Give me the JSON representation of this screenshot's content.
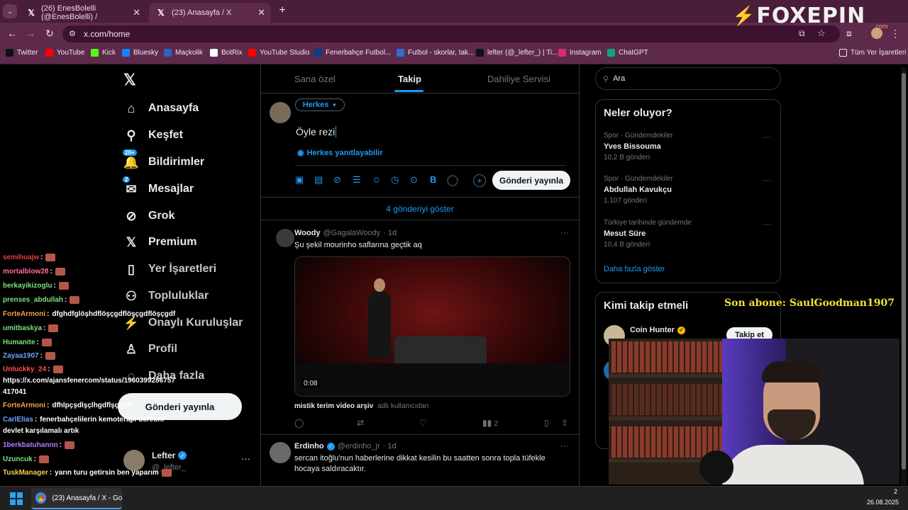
{
  "browser": {
    "tabs": [
      {
        "title": "(26) EnesBolelli (@EnesBolelli) /"
      },
      {
        "title": "(23) Anasayfa / X"
      }
    ],
    "url": "x.com/home",
    "bookmarks": [
      {
        "label": "Twitter"
      },
      {
        "label": "YouTube"
      },
      {
        "label": "Kick"
      },
      {
        "label": "Bluesky"
      },
      {
        "label": "Maçkolik"
      },
      {
        "label": "BotRix"
      },
      {
        "label": "YouTube Studio"
      },
      {
        "label": "Fenerbahçe Futbol..."
      },
      {
        "label": "Futbol - skorlar, tak..."
      },
      {
        "label": "lefter (@_lefter_) | Ti..."
      },
      {
        "label": "Instagram"
      },
      {
        "label": "ChatGPT"
      }
    ],
    "all_bookmarks": "Tüm Yer İşaretleri"
  },
  "overlay": {
    "logo_text": "FOXEPIN",
    "logo_sub": ".com",
    "son_abone": "Son abone: SaulGoodman1907"
  },
  "nav": {
    "items": [
      {
        "label": "Anasayfa"
      },
      {
        "label": "Keşfet"
      },
      {
        "label": "Bildirimler",
        "badge": "20+"
      },
      {
        "label": "Mesajlar",
        "badge": "2"
      },
      {
        "label": "Grok"
      },
      {
        "label": "Premium"
      },
      {
        "label": "Yer İşaretleri"
      },
      {
        "label": "Topluluklar"
      },
      {
        "label": "Onaylı Kuruluşlar"
      },
      {
        "label": "Profil"
      },
      {
        "label": "Daha fazla"
      }
    ],
    "post_button": "Gönderi yayınla",
    "account_name": "Lefter",
    "account_handle": "@_lefter_"
  },
  "timeline": {
    "tabs": [
      {
        "label": "Sana özel"
      },
      {
        "label": "Takip"
      },
      {
        "label": "Dahiliye Servisi"
      }
    ],
    "compose": {
      "audience": "Herkes",
      "text": "Öyle rezi",
      "reply_setting": "Herkes yanıtlayabilir",
      "post_button": "Gönderi yayınla"
    },
    "show_more": "4 gönderiyi göster",
    "posts": [
      {
        "name": "Woody",
        "handle": "@GagalaWoody",
        "time": "· 1d",
        "text": "Şu şekil mourinho saflarına geçtik aq",
        "video_time": "0:08",
        "caption_link": "mistik terim video arşiv",
        "caption_rest": "adlı kullanıcıdan",
        "views": "2"
      },
      {
        "name": "Erdinho",
        "handle": "@erdinho_jr",
        "time": "· 1d",
        "text": "sercan itoğlu'nun haberlerine dikkat kesilin bu saatten sonra topla tüfekle hocaya saldıracaktır."
      }
    ]
  },
  "sidebar": {
    "search_placeholder": "Ara",
    "trends_title": "Neler oluyor?",
    "trends": [
      {
        "meta": "Spor · Gündemdekiler",
        "title": "Yves Bissouma",
        "count": "10,2 B gönderi"
      },
      {
        "meta": "Spor · Gündemdekiler",
        "title": "Abdullah Kavukçu",
        "count": "1.107 gönderi"
      },
      {
        "meta": "Türkiye tarihinde gündemde",
        "title": "Mesut Süre",
        "count": "10,4 B gönderi"
      }
    ],
    "show_more": "Daha fazla göster",
    "who_to_follow": "Kimi takip etmeli",
    "suggestion_name": "Coin Hunter",
    "follow_button": "Takip et"
  },
  "chat": [
    {
      "user": "semihuajw",
      "msg": "",
      "color": "#e0403a"
    },
    {
      "user": "mortalblow28",
      "msg": "",
      "color": "#ff6fa0"
    },
    {
      "user": "berkayikizoglu",
      "msg": "",
      "color": "#7ee07e"
    },
    {
      "user": "prenses_abdullah",
      "msg": "",
      "color": "#7ee07e"
    },
    {
      "user": "ForteArmoni",
      "msg": "dfghdfglöşhdflöşçgdflöşçgdflöşçgdf",
      "color": "#f4a14c"
    },
    {
      "user": "umitbaskya",
      "msg": "",
      "color": "#7ee07e"
    },
    {
      "user": "Humanite",
      "msg": "",
      "color": "#7ee07e"
    },
    {
      "user": "Zayaa1907",
      "msg": "",
      "color": "#6aa6ff"
    },
    {
      "user": "Unluckky_24",
      "msg": "",
      "color": "#ff4d4d"
    },
    {
      "user": "",
      "msg": "https://x.com/ajansfenercom/status/1960399286757",
      "color": "#ffffff"
    },
    {
      "user": "",
      "msg": "417041",
      "color": "#ffffff"
    },
    {
      "user": "ForteArmoni",
      "msg": "dfhlpçşdlşçlhgdflşçlgdf",
      "color": "#f4a14c"
    },
    {
      "user": "CarlElias",
      "msg": "fenerbahçelilerin kemoterapi ücretini",
      "color": "#6aa6ff"
    },
    {
      "user": "",
      "msg": "devlet karşılamalı artık",
      "color": "#ffffff"
    },
    {
      "user": "1berkbatuhannn",
      "msg": "",
      "color": "#b57bff"
    },
    {
      "user": "Uzuncuk",
      "msg": "",
      "color": "#7ee07e"
    },
    {
      "user": "TuskManager",
      "msg": "yarın turu getirsin ben yaparım",
      "color": "#f4d04c"
    }
  ],
  "taskbar": {
    "app_label": "(23) Anasayfa / X - Goo",
    "time": "2",
    "date": "26.08.2025"
  },
  "colors": {
    "tabstrip": "#4a1d3a",
    "toolbar": "#5e2a4c",
    "accent": "#1d9bf0",
    "verified": "#f5b400"
  }
}
